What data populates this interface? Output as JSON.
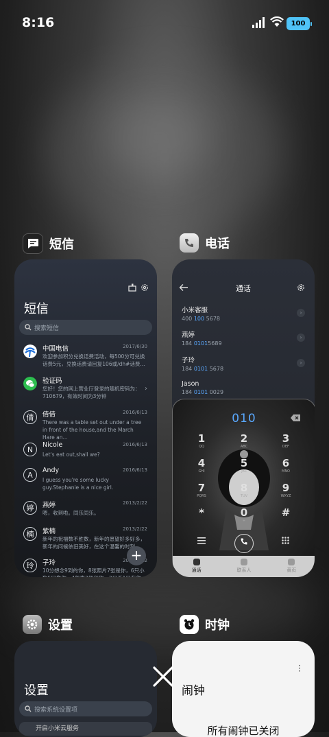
{
  "status_bar": {
    "time": "8:16",
    "battery": "100"
  },
  "apps": {
    "sms": {
      "app_name": "短信",
      "title": "短信",
      "search_placeholder": "搜索短信",
      "messages": [
        {
          "avatar": "",
          "name": "中国电信",
          "date": "2017/6/30",
          "preview": "欢迎参加积分兑换话费活动，每500分可兑换话费5元，兑换话费请回复106或/dh#话费..."
        },
        {
          "avatar": "",
          "name": "验证码",
          "date": "",
          "preview": "您好！您的网上营业厅登录的随机密码为：710679，有效时间为3分钟"
        },
        {
          "avatar": "倩",
          "name": "倩倩",
          "date": "2016/6/13",
          "preview": "There was a table set out under a tree in front of the house,and the March Hare an..."
        },
        {
          "avatar": "N",
          "name": "Nicole",
          "date": "2016/6/13",
          "preview": "Let's eat out,shall we?"
        },
        {
          "avatar": "A",
          "name": "Andy",
          "date": "2016/6/13",
          "preview": "I guess you're some lucky guy.Stephanie is a nice girl."
        },
        {
          "avatar": "婷",
          "name": "燕婷",
          "date": "2013/2/22",
          "preview": "嗯，收到啦。同乐同乐。"
        },
        {
          "avatar": "楠",
          "name": "紫楠",
          "date": "2013/2/22",
          "preview": "新年的祝福数不胜数，新年的愿望好多好多，新年的问候依旧美好，在这个温馨的时刻..."
        },
        {
          "avatar": "玲",
          "name": "子玲",
          "date": "2013/2/22",
          "preview": "10分想念9到的你，8张照片7张是你，6只小狗5只像你，4般事3般和你，2只手1只有你"
        }
      ],
      "fab": "+"
    },
    "phone": {
      "app_name": "电话",
      "title": "通话",
      "contacts": [
        {
          "name": "小米客服",
          "num_a": "400 ",
          "num_hl": "100",
          "num_b": " 5678"
        },
        {
          "name": "燕婷",
          "num_a": "184 ",
          "num_hl": "0101",
          "num_b": "5689"
        },
        {
          "name": "子玲",
          "num_a": "184 ",
          "num_hl": "0101",
          "num_b": " 5678"
        },
        {
          "name": "Jason",
          "num_a": "184 ",
          "num_hl": "0101",
          "num_b": " 0029"
        }
      ],
      "dial_input": "010",
      "keys": [
        {
          "d": "1",
          "l": "QQ"
        },
        {
          "d": "2",
          "l": "ABC"
        },
        {
          "d": "3",
          "l": "DEF"
        },
        {
          "d": "4",
          "l": "GHI"
        },
        {
          "d": "5",
          "l": "JKL"
        },
        {
          "d": "6",
          "l": "MNO"
        },
        {
          "d": "7",
          "l": "PQRS"
        },
        {
          "d": "8",
          "l": "TUV"
        },
        {
          "d": "9",
          "l": "WXYZ"
        },
        {
          "d": "*",
          "l": ""
        },
        {
          "d": "0",
          "l": "+"
        },
        {
          "d": "#",
          "l": ""
        }
      ],
      "tabs": [
        "通话",
        "联系人",
        "黄页"
      ]
    },
    "settings": {
      "app_name": "设置",
      "title": "设置",
      "search_placeholder": "搜索系统设置项",
      "first_row": "开启小米云服务"
    },
    "clock": {
      "app_name": "时钟",
      "title": "闹钟",
      "empty_text": "所有闹钟已关闭"
    }
  }
}
